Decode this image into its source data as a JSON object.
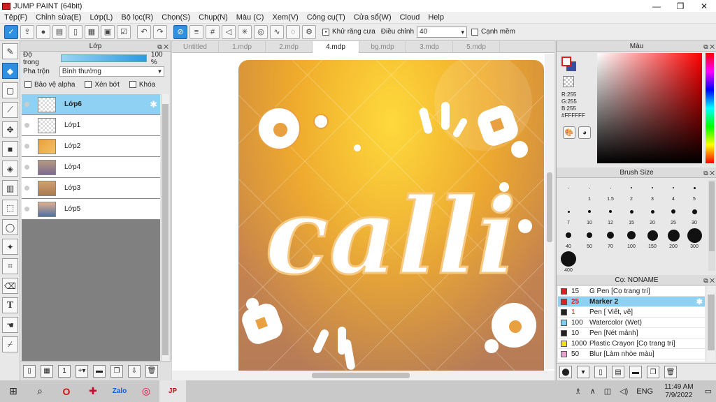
{
  "app": {
    "title": "JUMP PAINT (64bit)"
  },
  "menu": [
    "Tệp(F)",
    "Chỉnh sửa(E)",
    "Lớp(L)",
    "Bộ lọc(R)",
    "Chọn(S)",
    "Chụp(N)",
    "Màu (C)",
    "Xem(V)",
    "Công cụ(T)",
    "Cửa sổ(W)",
    "Cloud",
    "Help"
  ],
  "toolbar": {
    "antialias_label": "Khử răng cưa",
    "adjust_label": "Điều chỉnh",
    "adjust_value": "40",
    "sharp_edge_label": "Cạnh mềm"
  },
  "layer_panel": {
    "title": "Lớp",
    "opacity_label": "Độ trong",
    "opacity_value": "100 %",
    "opacity_fraction": 1.0,
    "blend_label": "Pha trộn",
    "blend_value": "Bình thường",
    "protect_alpha": "Bảo vệ alpha",
    "clip": "Xén bớt",
    "lock": "Khóa",
    "layers": [
      {
        "name": "Lớp6",
        "selected": true
      },
      {
        "name": "Lớp1",
        "selected": false
      },
      {
        "name": "Lớp2",
        "selected": false
      },
      {
        "name": "Lớp4",
        "selected": false
      },
      {
        "name": "Lớp3",
        "selected": false
      },
      {
        "name": "Lớp5",
        "selected": false
      }
    ]
  },
  "tabs": [
    "Untitled",
    "1.mdp",
    "2.mdp",
    "4.mdp",
    "bg.mdp",
    "3.mdp",
    "5.mdp"
  ],
  "active_tab": "4.mdp",
  "canvas": {
    "artwork_text": "calli"
  },
  "color_panel": {
    "title": "Màu",
    "r": "R:255",
    "g": "G:255",
    "b": "B:255",
    "hex": "#FFFFFF",
    "fg_color": "#FFFFFF",
    "bg_color": "#3050A0"
  },
  "brush_panel": {
    "title": "Brush Size",
    "sizes": [
      "0.7",
      "1",
      "1.5",
      "2",
      "3",
      "4",
      "5",
      "7",
      "10",
      "12",
      "15",
      "20",
      "25",
      "30",
      "40",
      "50",
      "70",
      "100",
      "150",
      "200",
      "300",
      "400"
    ],
    "sizes_visible_labels": [
      "1",
      "1.5",
      "2",
      "3",
      "4",
      "5",
      "7",
      "10",
      "12",
      "15",
      "20",
      "25",
      "30",
      "40",
      "50",
      "70",
      "100",
      "150",
      "200",
      "300",
      "400"
    ]
  },
  "preset_panel": {
    "title": "Cọ: NONAME",
    "presets": [
      {
        "size": "15",
        "name": "G Pen [Cọ trang trí]",
        "color": "#e02020",
        "selected": false
      },
      {
        "size": "25",
        "name": "Marker 2",
        "color": "#e02020",
        "selected": true
      },
      {
        "size": "1",
        "name": "Pen [ Viết, vẽ]",
        "color": "#222222",
        "selected": false
      },
      {
        "size": "100",
        "name": "Watercolor (Wet)",
        "color": "#7fd0f0",
        "selected": false
      },
      {
        "size": "10",
        "name": "Pen [Nét mảnh]",
        "color": "#222222",
        "selected": false
      },
      {
        "size": "1000",
        "name": "Plastic Crayon [Cọ trang trí]",
        "color": "#f0e020",
        "selected": false
      },
      {
        "size": "50",
        "name": "Blur [Làm nhòe màu]",
        "color": "#f0a0d0",
        "selected": false
      }
    ]
  },
  "taskbar": {
    "time": "11:49 AM",
    "date": "7/9/2022",
    "lang": "ENG"
  }
}
